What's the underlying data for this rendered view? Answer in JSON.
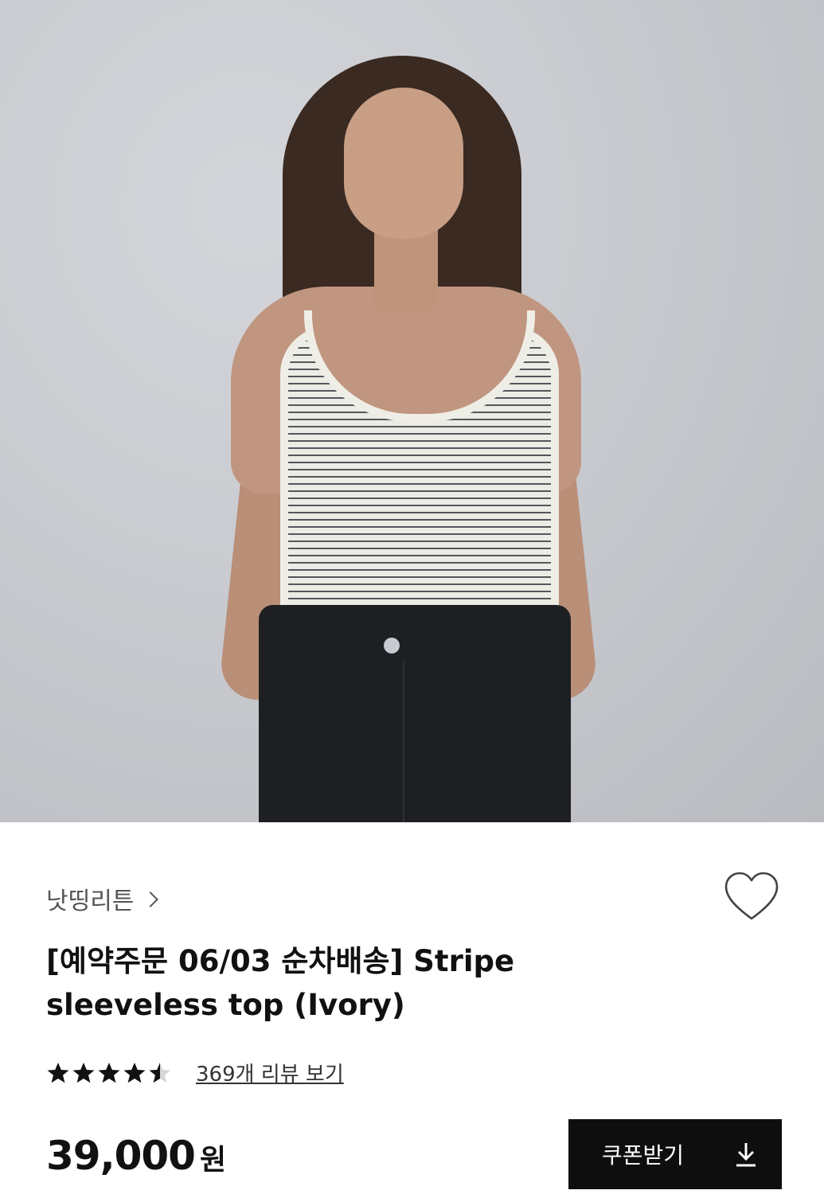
{
  "product": {
    "brand": "낫띵리튼",
    "title_line1": "[예약주문 06/03 순차배송] Stripe",
    "title_line2": "sleeveless top (Ivory)",
    "rating_value": 4.5,
    "rating_max": 5,
    "reviews_link": "369개 리뷰 보기",
    "price_number": "39,000",
    "price_currency": "원"
  },
  "coupon_button": {
    "label": "쿠폰받기",
    "icon": "download-icon"
  },
  "icons": {
    "brand_chevron": "chevron-right-icon",
    "wishlist": "heart-outline-icon",
    "rating": "star-icon"
  },
  "colors": {
    "button_bg": "#0e0e0e",
    "button_text": "#ffffff",
    "text_primary": "#111111",
    "text_secondary": "#555555"
  }
}
